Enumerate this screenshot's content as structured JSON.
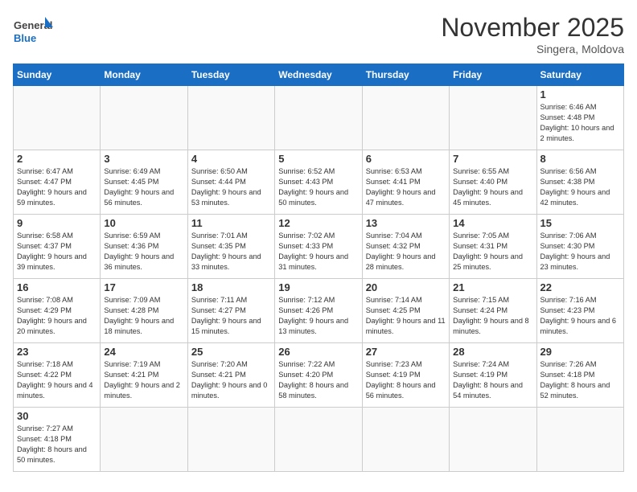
{
  "logo": {
    "text_general": "General",
    "text_blue": "Blue"
  },
  "title": "November 2025",
  "subtitle": "Singera, Moldova",
  "days_of_week": [
    "Sunday",
    "Monday",
    "Tuesday",
    "Wednesday",
    "Thursday",
    "Friday",
    "Saturday"
  ],
  "weeks": [
    [
      {
        "day": "",
        "info": ""
      },
      {
        "day": "",
        "info": ""
      },
      {
        "day": "",
        "info": ""
      },
      {
        "day": "",
        "info": ""
      },
      {
        "day": "",
        "info": ""
      },
      {
        "day": "",
        "info": ""
      },
      {
        "day": "1",
        "info": "Sunrise: 6:46 AM\nSunset: 4:48 PM\nDaylight: 10 hours\nand 2 minutes."
      }
    ],
    [
      {
        "day": "2",
        "info": "Sunrise: 6:47 AM\nSunset: 4:47 PM\nDaylight: 9 hours\nand 59 minutes."
      },
      {
        "day": "3",
        "info": "Sunrise: 6:49 AM\nSunset: 4:45 PM\nDaylight: 9 hours\nand 56 minutes."
      },
      {
        "day": "4",
        "info": "Sunrise: 6:50 AM\nSunset: 4:44 PM\nDaylight: 9 hours\nand 53 minutes."
      },
      {
        "day": "5",
        "info": "Sunrise: 6:52 AM\nSunset: 4:43 PM\nDaylight: 9 hours\nand 50 minutes."
      },
      {
        "day": "6",
        "info": "Sunrise: 6:53 AM\nSunset: 4:41 PM\nDaylight: 9 hours\nand 47 minutes."
      },
      {
        "day": "7",
        "info": "Sunrise: 6:55 AM\nSunset: 4:40 PM\nDaylight: 9 hours\nand 45 minutes."
      },
      {
        "day": "8",
        "info": "Sunrise: 6:56 AM\nSunset: 4:38 PM\nDaylight: 9 hours\nand 42 minutes."
      }
    ],
    [
      {
        "day": "9",
        "info": "Sunrise: 6:58 AM\nSunset: 4:37 PM\nDaylight: 9 hours\nand 39 minutes."
      },
      {
        "day": "10",
        "info": "Sunrise: 6:59 AM\nSunset: 4:36 PM\nDaylight: 9 hours\nand 36 minutes."
      },
      {
        "day": "11",
        "info": "Sunrise: 7:01 AM\nSunset: 4:35 PM\nDaylight: 9 hours\nand 33 minutes."
      },
      {
        "day": "12",
        "info": "Sunrise: 7:02 AM\nSunset: 4:33 PM\nDaylight: 9 hours\nand 31 minutes."
      },
      {
        "day": "13",
        "info": "Sunrise: 7:04 AM\nSunset: 4:32 PM\nDaylight: 9 hours\nand 28 minutes."
      },
      {
        "day": "14",
        "info": "Sunrise: 7:05 AM\nSunset: 4:31 PM\nDaylight: 9 hours\nand 25 minutes."
      },
      {
        "day": "15",
        "info": "Sunrise: 7:06 AM\nSunset: 4:30 PM\nDaylight: 9 hours\nand 23 minutes."
      }
    ],
    [
      {
        "day": "16",
        "info": "Sunrise: 7:08 AM\nSunset: 4:29 PM\nDaylight: 9 hours\nand 20 minutes."
      },
      {
        "day": "17",
        "info": "Sunrise: 7:09 AM\nSunset: 4:28 PM\nDaylight: 9 hours\nand 18 minutes."
      },
      {
        "day": "18",
        "info": "Sunrise: 7:11 AM\nSunset: 4:27 PM\nDaylight: 9 hours\nand 15 minutes."
      },
      {
        "day": "19",
        "info": "Sunrise: 7:12 AM\nSunset: 4:26 PM\nDaylight: 9 hours\nand 13 minutes."
      },
      {
        "day": "20",
        "info": "Sunrise: 7:14 AM\nSunset: 4:25 PM\nDaylight: 9 hours\nand 11 minutes."
      },
      {
        "day": "21",
        "info": "Sunrise: 7:15 AM\nSunset: 4:24 PM\nDaylight: 9 hours\nand 8 minutes."
      },
      {
        "day": "22",
        "info": "Sunrise: 7:16 AM\nSunset: 4:23 PM\nDaylight: 9 hours\nand 6 minutes."
      }
    ],
    [
      {
        "day": "23",
        "info": "Sunrise: 7:18 AM\nSunset: 4:22 PM\nDaylight: 9 hours\nand 4 minutes."
      },
      {
        "day": "24",
        "info": "Sunrise: 7:19 AM\nSunset: 4:21 PM\nDaylight: 9 hours\nand 2 minutes."
      },
      {
        "day": "25",
        "info": "Sunrise: 7:20 AM\nSunset: 4:21 PM\nDaylight: 9 hours\nand 0 minutes."
      },
      {
        "day": "26",
        "info": "Sunrise: 7:22 AM\nSunset: 4:20 PM\nDaylight: 8 hours\nand 58 minutes."
      },
      {
        "day": "27",
        "info": "Sunrise: 7:23 AM\nSunset: 4:19 PM\nDaylight: 8 hours\nand 56 minutes."
      },
      {
        "day": "28",
        "info": "Sunrise: 7:24 AM\nSunset: 4:19 PM\nDaylight: 8 hours\nand 54 minutes."
      },
      {
        "day": "29",
        "info": "Sunrise: 7:26 AM\nSunset: 4:18 PM\nDaylight: 8 hours\nand 52 minutes."
      }
    ],
    [
      {
        "day": "30",
        "info": "Sunrise: 7:27 AM\nSunset: 4:18 PM\nDaylight: 8 hours\nand 50 minutes."
      },
      {
        "day": "",
        "info": ""
      },
      {
        "day": "",
        "info": ""
      },
      {
        "day": "",
        "info": ""
      },
      {
        "day": "",
        "info": ""
      },
      {
        "day": "",
        "info": ""
      },
      {
        "day": "",
        "info": ""
      }
    ]
  ]
}
